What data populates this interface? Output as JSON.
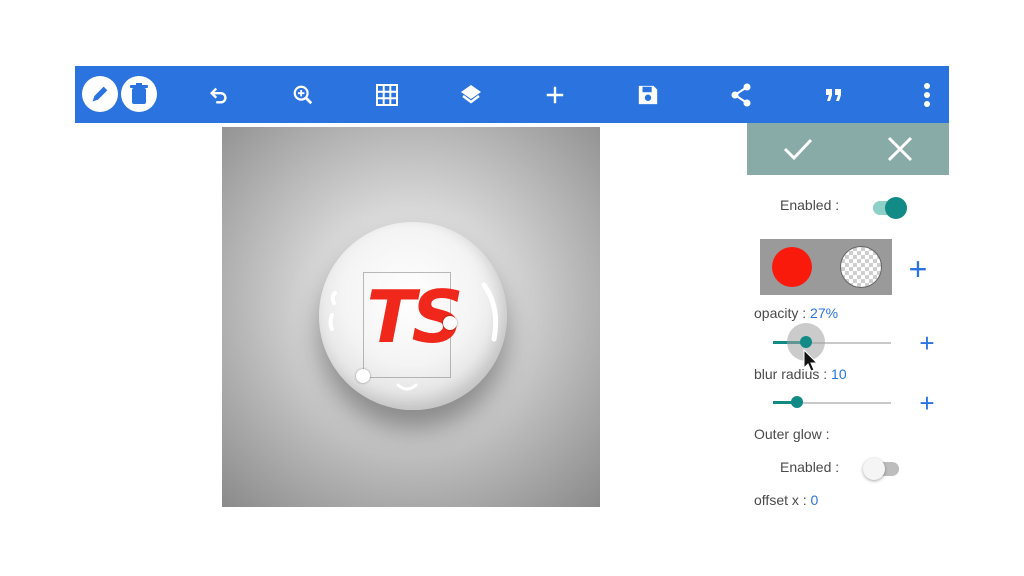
{
  "toolbar": {
    "background": "#2b74e0",
    "icons": [
      "pencil-icon",
      "trash-icon",
      "undo-icon",
      "zoom-in-icon",
      "grid-icon",
      "layers-icon",
      "add-icon",
      "save-icon",
      "share-icon",
      "quote-icon",
      "more-vert-icon"
    ]
  },
  "canvas": {
    "logo_text": "TS",
    "logo_color": "#f0281c"
  },
  "panel": {
    "header_color": "#88aba7",
    "confirm_icon": "check-icon",
    "cancel_icon": "close-icon",
    "enabled_label": "Enabled :",
    "enabled_on": true,
    "colors": [
      "#fa1a0c",
      "transparent"
    ],
    "opacity_label": "opacity : ",
    "opacity_value": "27%",
    "opacity_level": 0.27,
    "blur_label": "blur radius : ",
    "blur_value": "10",
    "outer_glow_label": "Outer glow :",
    "outer_enabled_label": "Enabled :",
    "outer_enabled_on": false,
    "offset_x_label": "offset x : ",
    "offset_x_value": "0",
    "accent": "#128a86"
  }
}
